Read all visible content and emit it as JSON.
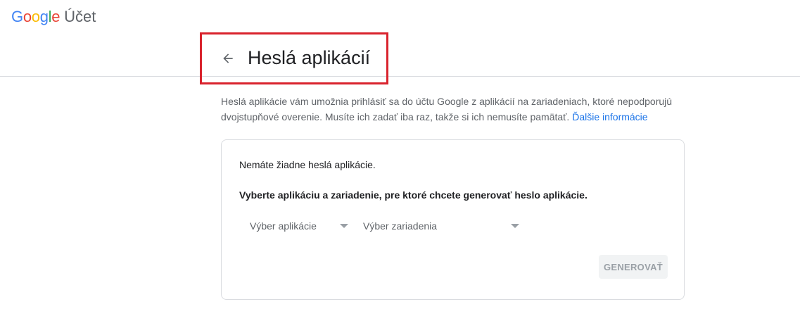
{
  "logo": {
    "letters": [
      {
        "char": "G",
        "color": "#4285F4"
      },
      {
        "char": "o",
        "color": "#EA4335"
      },
      {
        "char": "o",
        "color": "#FBBC05"
      },
      {
        "char": "g",
        "color": "#4285F4"
      },
      {
        "char": "l",
        "color": "#34A853"
      },
      {
        "char": "e",
        "color": "#EA4335"
      }
    ],
    "product": "Účet"
  },
  "header": {
    "back_icon": "arrow-left-icon",
    "title": "Heslá aplikácií"
  },
  "intro": {
    "text": "Heslá aplikácie vám umožnia prihlásiť sa do účtu Google z aplikácií na zariadeniach, ktoré nepodporujú dvojstupňové overenie. Musíte ich zadať iba raz, takže si ich nemusíte pamätať. ",
    "link": "Ďalšie informácie"
  },
  "card": {
    "no_passwords": "Nemáte žiadne heslá aplikácie.",
    "instruction": "Vyberte aplikáciu a zariadenie, pre ktoré chcete generovať heslo aplikácie.",
    "app_select": "Výber aplikácie",
    "device_select": "Výber zariadenia",
    "generate_button": "GENEROVAŤ"
  },
  "colors": {
    "highlight": "#d9232d",
    "link": "#1a73e8"
  }
}
